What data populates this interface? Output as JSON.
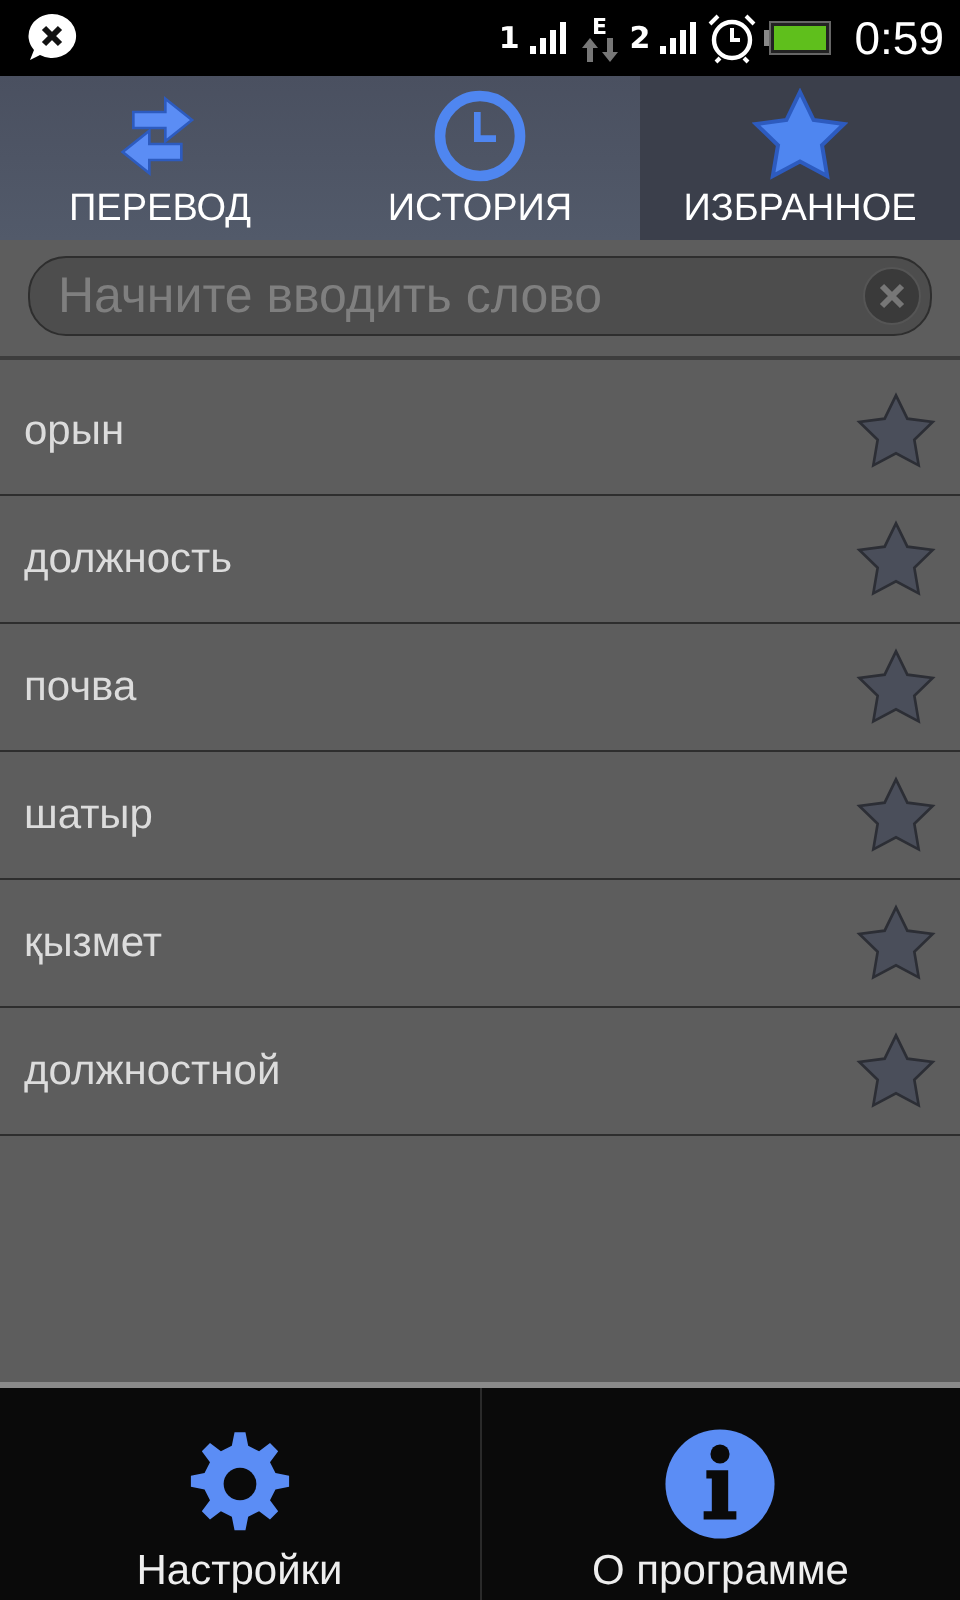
{
  "status_bar": {
    "sim_labels": [
      "1",
      "2"
    ],
    "network": "E",
    "time": "0:59"
  },
  "tabs": [
    {
      "label": "ПЕРЕВОД",
      "kind": "swap",
      "selected": false
    },
    {
      "label": "ИСТОРИЯ",
      "kind": "clock",
      "selected": false
    },
    {
      "label": "ИЗБРАННОЕ",
      "kind": "star",
      "selected": true
    }
  ],
  "search": {
    "placeholder": "Начните вводить слово"
  },
  "words": [
    {
      "text": "орын",
      "starred": false
    },
    {
      "text": "должность",
      "starred": false
    },
    {
      "text": "почва",
      "starred": false
    },
    {
      "text": "шатыр",
      "starred": false
    },
    {
      "text": "қызмет",
      "starred": false
    },
    {
      "text": "должностной",
      "starred": false
    }
  ],
  "bottom_menu": [
    {
      "label": "Настройки",
      "kind": "gear"
    },
    {
      "label": "О программе",
      "kind": "info"
    }
  ]
}
